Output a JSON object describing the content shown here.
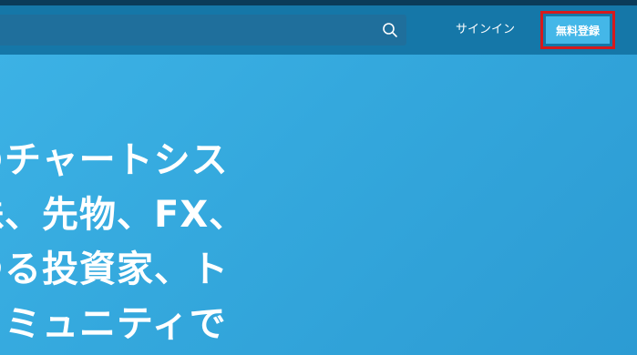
{
  "header": {
    "search": {
      "value": "",
      "placeholder": ""
    },
    "signin_label": "サインイン",
    "signup_label": "無料登録"
  },
  "hero": {
    "lines": [
      "のチャートシス",
      "株、先物、FX、",
      "ゆる投資家、ト",
      "コミュニティで"
    ]
  },
  "colors": {
    "header_bg": "#1577a8",
    "top_strip": "#0b3b59",
    "hero_bg": "#3aafe3",
    "signup_highlight": "#d7191c"
  },
  "icons": [
    "search-icon"
  ]
}
